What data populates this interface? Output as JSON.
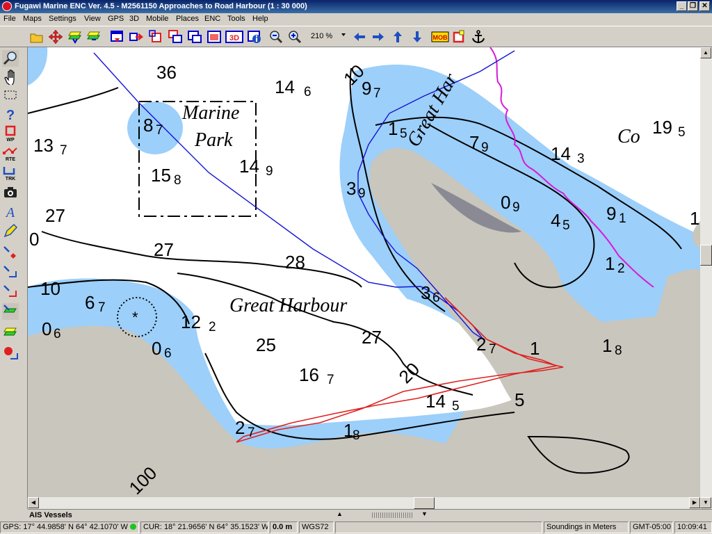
{
  "window": {
    "title": "Fugawi Marine ENC Ver. 4.5 - M2561150  Approaches to Road Harbour  (1 : 30 000)",
    "minimize_label": "_",
    "restore_label": "❐",
    "close_label": "✕"
  },
  "menu": [
    "File",
    "Maps",
    "Settings",
    "View",
    "GPS",
    "3D",
    "Mobile",
    "Places",
    "ENC",
    "Tools",
    "Help"
  ],
  "toolbar": {
    "zoom_value": "210 %",
    "mob_label": "MOB",
    "threed_label": "3D"
  },
  "colors": {
    "shallow_water": "#9ccffa",
    "land": "#c9c6bd",
    "route": "#1414d6",
    "track": "#e02020",
    "boundary": "#d81ad8"
  },
  "chart": {
    "soundings": [
      {
        "main": "36",
        "sub": ""
      },
      {
        "main": "14",
        "sub": "6"
      },
      {
        "main": "8",
        "sub": "7"
      },
      {
        "main": "13",
        "sub": "7"
      },
      {
        "main": "15",
        "sub": "8"
      },
      {
        "main": "14",
        "sub": "9"
      },
      {
        "main": "27",
        "sub": ""
      },
      {
        "main": "27",
        "sub": ""
      },
      {
        "main": "28",
        "sub": ""
      },
      {
        "main": "0",
        "sub": ""
      },
      {
        "main": "10",
        "sub": ""
      },
      {
        "main": "6",
        "sub": "7"
      },
      {
        "main": "0",
        "sub": "6"
      },
      {
        "main": "0",
        "sub": "6"
      },
      {
        "main": "12",
        "sub": "2"
      },
      {
        "main": "25",
        "sub": ""
      },
      {
        "main": "16",
        "sub": "7"
      },
      {
        "main": "27",
        "sub": ""
      },
      {
        "main": "20",
        "sub": ""
      },
      {
        "main": "2",
        "sub": "7"
      },
      {
        "main": "1",
        "sub": "8"
      },
      {
        "main": "14",
        "sub": "5"
      },
      {
        "main": "5",
        "sub": ""
      },
      {
        "main": "100",
        "sub": ""
      },
      {
        "main": "10",
        "sub": ""
      },
      {
        "main": "9",
        "sub": "7"
      },
      {
        "main": "1",
        "sub": "5"
      },
      {
        "main": "3",
        "sub": "9"
      },
      {
        "main": "7",
        "sub": "9"
      },
      {
        "main": "0",
        "sub": "9"
      },
      {
        "main": "4",
        "sub": "5"
      },
      {
        "main": "14",
        "sub": "3"
      },
      {
        "main": "9",
        "sub": "1"
      },
      {
        "main": "1",
        "sub": "2"
      },
      {
        "main": "1",
        "sub": "8"
      },
      {
        "main": "19",
        "sub": "5"
      },
      {
        "main": "3",
        "sub": "6"
      },
      {
        "main": "2",
        "sub": "7"
      },
      {
        "main": "1",
        "sub": ""
      },
      {
        "main": "1",
        "sub": ""
      }
    ],
    "labels": {
      "marine": "Marine",
      "park": "Park",
      "great_harbour": "Great Harbour",
      "great_har": "Great Har",
      "co": "Co"
    }
  },
  "ais_label": "AIS Vessels",
  "status": {
    "gps": "GPS: 17° 44.9858' N 64° 42.1070' W",
    "cur": "CUR: 18° 21.9656' N 64° 35.1523' W",
    "range": "0.0 m",
    "datum": "WGS72",
    "soundings": "Soundings in Meters",
    "tz": "GMT-05:00",
    "time": "10:09:41"
  }
}
